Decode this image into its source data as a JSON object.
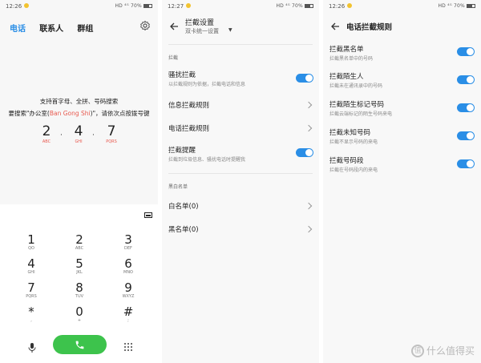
{
  "panel1": {
    "status": {
      "time": "12:26",
      "signal": "HD ⁴ᴳ 70%"
    },
    "tabs": [
      {
        "label": "电话",
        "active": true
      },
      {
        "label": "联系人",
        "active": false
      },
      {
        "label": "群组",
        "active": false
      }
    ],
    "hint_line1": "支持首字母、全拼、号码搜索",
    "hint_line2_pre": "要搜索\"办公室(",
    "hint_line2_highlight": "Ban Gong Shi",
    "hint_line2_post": ")\"，请依次点按拨号键",
    "demo": [
      {
        "digit": "2",
        "letters": "ABC"
      },
      {
        "digit": "4",
        "letters": "GHI"
      },
      {
        "digit": "7",
        "letters": "PQRS"
      }
    ],
    "demo_sep": "·",
    "keys": [
      {
        "n": "1",
        "s": "QO"
      },
      {
        "n": "2",
        "s": "ABC"
      },
      {
        "n": "3",
        "s": "DEF"
      },
      {
        "n": "4",
        "s": "GHI"
      },
      {
        "n": "5",
        "s": "JKL"
      },
      {
        "n": "6",
        "s": "MNO"
      },
      {
        "n": "7",
        "s": "PQRS"
      },
      {
        "n": "8",
        "s": "TUV"
      },
      {
        "n": "9",
        "s": "WXYZ"
      },
      {
        "n": "*",
        "s": ","
      },
      {
        "n": "0",
        "s": "+"
      },
      {
        "n": "#",
        "s": ";"
      }
    ]
  },
  "panel2": {
    "status": {
      "time": "12:27",
      "signal": "HD ⁴ᴳ 70%"
    },
    "title": "拦截设置",
    "subtitle": "双卡统一设置",
    "section1": "拦截",
    "rows": [
      {
        "title": "骚扰拦截",
        "desc": "以拦截规则为依据，拦截电话和信息",
        "toggle": true
      },
      {
        "title": "信息拦截规则",
        "chevron": true
      },
      {
        "title": "电话拦截规则",
        "chevron": true
      },
      {
        "title": "拦截提醒",
        "desc": "拦截到垃圾信息、骚扰电话时提醒我",
        "toggle": true
      }
    ],
    "section2": "黑白名单",
    "list_rows": [
      {
        "title": "白名单(0)"
      },
      {
        "title": "黑名单(0)"
      }
    ]
  },
  "panel3": {
    "status": {
      "time": "12:26",
      "signal": "HD ⁴ᴳ 70%"
    },
    "title": "电话拦截规则",
    "rows": [
      {
        "title": "拦截黑名单",
        "desc": "拦截黑名单中的号码"
      },
      {
        "title": "拦截陌生人",
        "desc": "拦截未在通讯录中的号码"
      },
      {
        "title": "拦截陌生标记号码",
        "desc": "拦截云端标记的陌生号码来电"
      },
      {
        "title": "拦截未知号码",
        "desc": "拦截不显示号码的来电"
      },
      {
        "title": "拦截号码段",
        "desc": "拦截在号码段内的来电"
      }
    ]
  },
  "watermark": {
    "glyph": "值",
    "text": "什么值得买"
  },
  "colors": {
    "accent": "#2a8ee6",
    "call_green": "#3dc34c",
    "highlight": "#e85a4f"
  }
}
